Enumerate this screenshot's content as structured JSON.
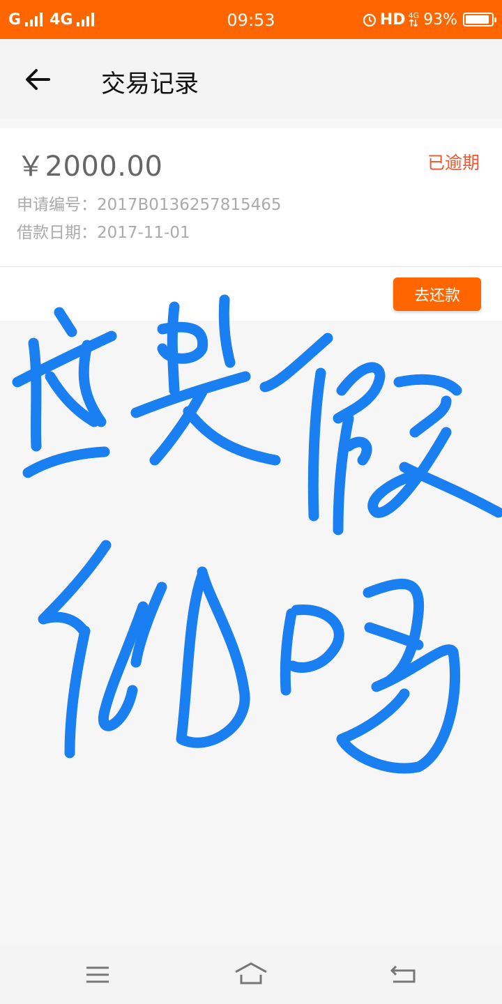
{
  "status_bar": {
    "carrier1": "G",
    "carrier2": "4G",
    "time": "09:53",
    "hd": "HD",
    "net_small_top": "4G",
    "battery_text": "93%",
    "battery_level": 0.93,
    "color": "#ff6600"
  },
  "header": {
    "title": "交易记录",
    "back_icon": "arrow-left-icon"
  },
  "record": {
    "amount": "￥2000.00",
    "status": "已逾期",
    "application_label": "申请编号：",
    "application_no": "2017B0136257815465",
    "loan_date_label": "借款日期：",
    "loan_date": "2017-11-01",
    "repay_button": "去还款",
    "accent_color": "#ff6600",
    "status_color": "#f0552e"
  },
  "handwriting": {
    "text": "这是假的吗",
    "color": "#1a7ff0"
  },
  "nav_bar": {
    "menu_icon": "menu-icon",
    "home_icon": "home-icon",
    "back_icon": "return-icon"
  }
}
